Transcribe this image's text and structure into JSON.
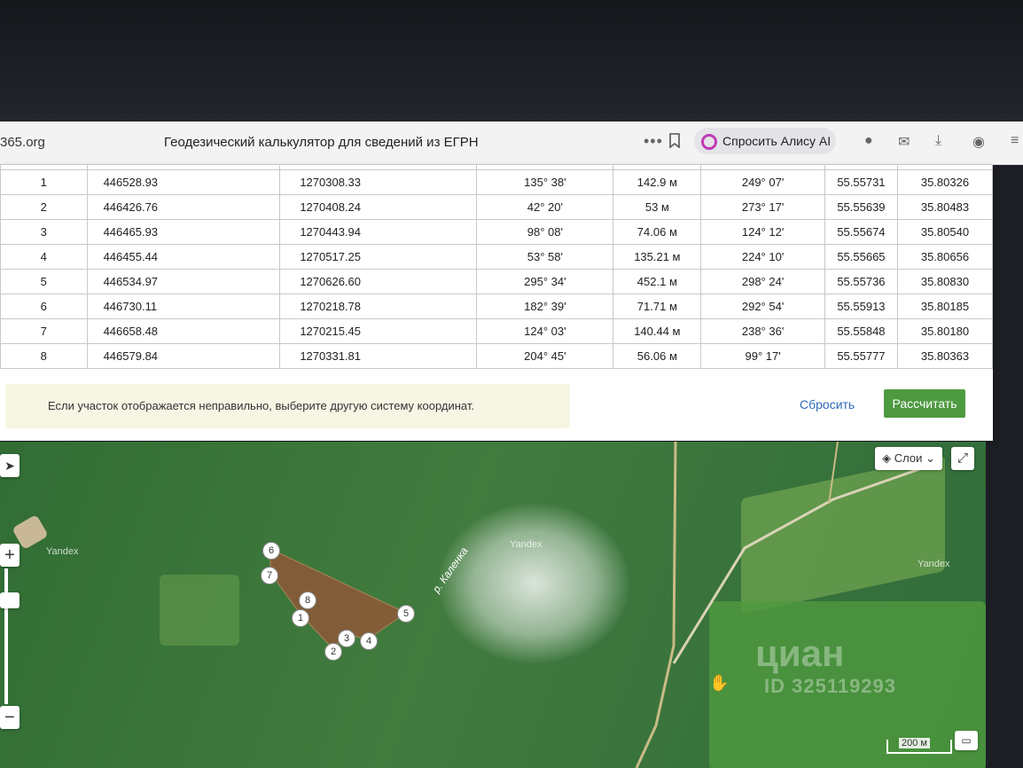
{
  "browser": {
    "url_fragment": "365.org",
    "page_title": "Геодезический калькулятор для сведений из ЕГРН",
    "more_icon": "•••",
    "alice_label": "Спросить Алису AI",
    "icons": [
      "bookmark-icon",
      "alice-icon",
      "avatar-icon",
      "chat-icon",
      "download-icon",
      "profile-icon",
      "menu-icon"
    ]
  },
  "table": {
    "rows": [
      {
        "n": "1",
        "x": "446528.93",
        "y": "1270308.33",
        "angle": "135° 38'",
        "length": "142.9 м",
        "direction": "249° 07'",
        "lat": "55.55731",
        "lon": "35.80326"
      },
      {
        "n": "2",
        "x": "446426.76",
        "y": "1270408.24",
        "angle": "42° 20'",
        "length": "53 м",
        "direction": "273° 17'",
        "lat": "55.55639",
        "lon": "35.80483"
      },
      {
        "n": "3",
        "x": "446465.93",
        "y": "1270443.94",
        "angle": "98° 08'",
        "length": "74.06 м",
        "direction": "124° 12'",
        "lat": "55.55674",
        "lon": "35.80540"
      },
      {
        "n": "4",
        "x": "446455.44",
        "y": "1270517.25",
        "angle": "53° 58'",
        "length": "135.21 м",
        "direction": "224° 10'",
        "lat": "55.55665",
        "lon": "35.80656"
      },
      {
        "n": "5",
        "x": "446534.97",
        "y": "1270626.60",
        "angle": "295° 34'",
        "length": "452.1 м",
        "direction": "298° 24'",
        "lat": "55.55736",
        "lon": "35.80830"
      },
      {
        "n": "6",
        "x": "446730.11",
        "y": "1270218.78",
        "angle": "182° 39'",
        "length": "71.71 м",
        "direction": "292° 54'",
        "lat": "55.55913",
        "lon": "35.80185"
      },
      {
        "n": "7",
        "x": "446658.48",
        "y": "1270215.45",
        "angle": "124° 03'",
        "length": "140.44 м",
        "direction": "238° 36'",
        "lat": "55.55848",
        "lon": "35.80180"
      },
      {
        "n": "8",
        "x": "446579.84",
        "y": "1270331.81",
        "angle": "204° 45'",
        "length": "56.06 м",
        "direction": "99° 17'",
        "lat": "55.55777",
        "lon": "35.80363"
      }
    ]
  },
  "notice": {
    "text": "Если участок отображается неправильно, выберите другую систему координат."
  },
  "actions": {
    "reset_label": "Сбросить",
    "calculate_label": "Рассчитать"
  },
  "map": {
    "layers_label": "Слои",
    "river_label": "р. Каленка",
    "provider_labels": [
      "Yandex",
      "Yandex",
      "Yandex"
    ],
    "markers": [
      "1",
      "2",
      "3",
      "4",
      "5",
      "6",
      "7",
      "8"
    ],
    "scale_label": "200 м",
    "watermark_logo": "циан",
    "watermark_id": "ID 325119293",
    "icons": [
      "locate-icon",
      "zoom-in-icon",
      "zoom-out-icon",
      "layers-icon",
      "fullscreen-icon",
      "ruler-icon",
      "hand-cursor-icon"
    ]
  },
  "colors": {
    "plot_fill": "#8a5a38",
    "calculate_button": "#4e9a41",
    "link": "#2f6cb8",
    "notice_bg": "#f7f6e4"
  }
}
